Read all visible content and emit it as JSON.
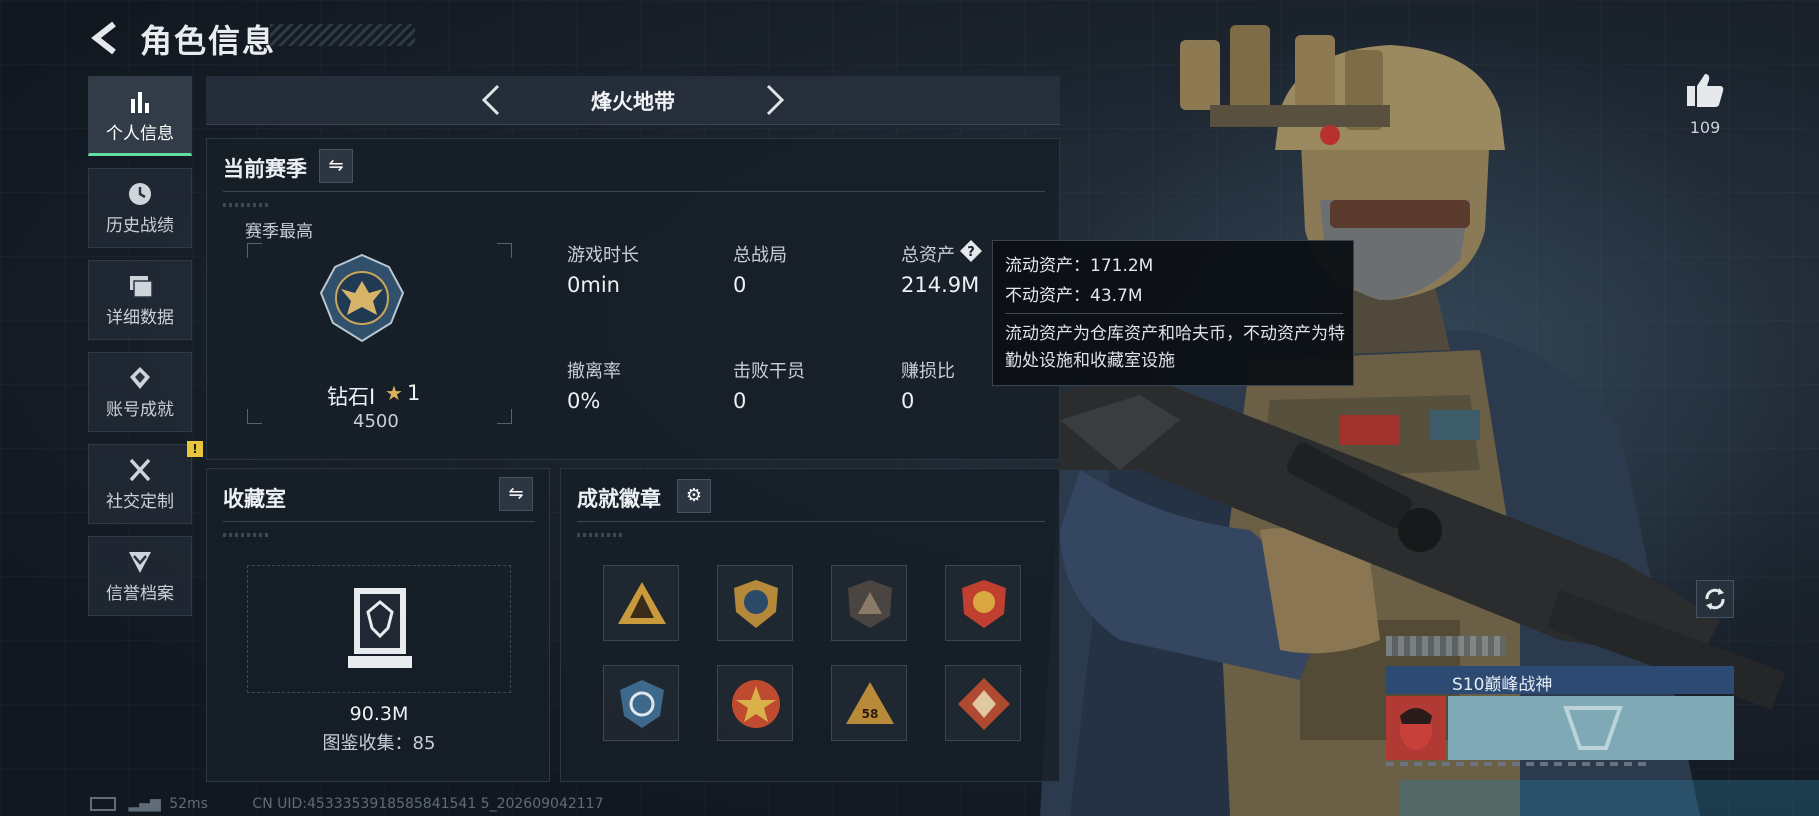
{
  "header": {
    "title": "角色信息"
  },
  "nav": {
    "items": [
      {
        "label": "个人信息",
        "icon": "bar-chart-icon",
        "active": true
      },
      {
        "label": "历史战绩",
        "icon": "clock-icon"
      },
      {
        "label": "详细数据",
        "icon": "folder-icon"
      },
      {
        "label": "账号成就",
        "icon": "medal-icon"
      },
      {
        "label": "社交定制",
        "icon": "tools-icon",
        "badge": "!"
      },
      {
        "label": "信誉档案",
        "icon": "shield-chevron-icon"
      }
    ]
  },
  "mode": {
    "title": "烽火地带"
  },
  "season": {
    "title": "当前赛季",
    "best_label": "赛季最高",
    "rank_name": "钻石Ⅰ",
    "rank_star_count": "1",
    "rank_points": "4500",
    "stats": [
      {
        "label": "游戏时长",
        "value": "0min"
      },
      {
        "label": "总战局",
        "value": "0"
      },
      {
        "label": "总资产",
        "value": "214.9M"
      },
      {
        "label": "撤离率",
        "value": "0%"
      },
      {
        "label": "击败干员",
        "value": "0"
      },
      {
        "label": "赚损比",
        "value": "0"
      }
    ]
  },
  "tooltip": {
    "liquid": "流动资产：171.2M",
    "fixed": "不动资产：43.7M",
    "desc": "流动资产为仓库资产和哈夫币，不动资产为特勤处设施和收藏室设施"
  },
  "collection": {
    "title": "收藏室",
    "value": "90.3M",
    "count_text": "图鉴收集：85"
  },
  "achievements": {
    "title": "成就徽章",
    "badges": [
      {
        "icon": "triangle-emblem-icon",
        "color": "#c99a3c"
      },
      {
        "icon": "crest-shield-icon",
        "color": "#b48a3a"
      },
      {
        "icon": "triangle-shield-icon",
        "color": "#8a7a68"
      },
      {
        "icon": "red-crest-icon",
        "color": "#c04030"
      },
      {
        "icon": "navy-shield-icon",
        "color": "#3d6a8c"
      },
      {
        "icon": "star-medal-icon",
        "color": "#c04a30"
      },
      {
        "icon": "numbered-triangle-icon",
        "color": "#b88a3a",
        "number": "58"
      },
      {
        "icon": "wolf-diamond-icon",
        "color": "#b04a30"
      }
    ]
  },
  "like": {
    "count": "109"
  },
  "player": {
    "title": "S10巅峰战神"
  },
  "status": {
    "ping": "52ms",
    "uid": "CN UID:4533353918585841541 5_202609042117"
  },
  "colors": {
    "accent": "#5fe0a0",
    "warn": "#e8c53a",
    "panel": "#161e27"
  }
}
